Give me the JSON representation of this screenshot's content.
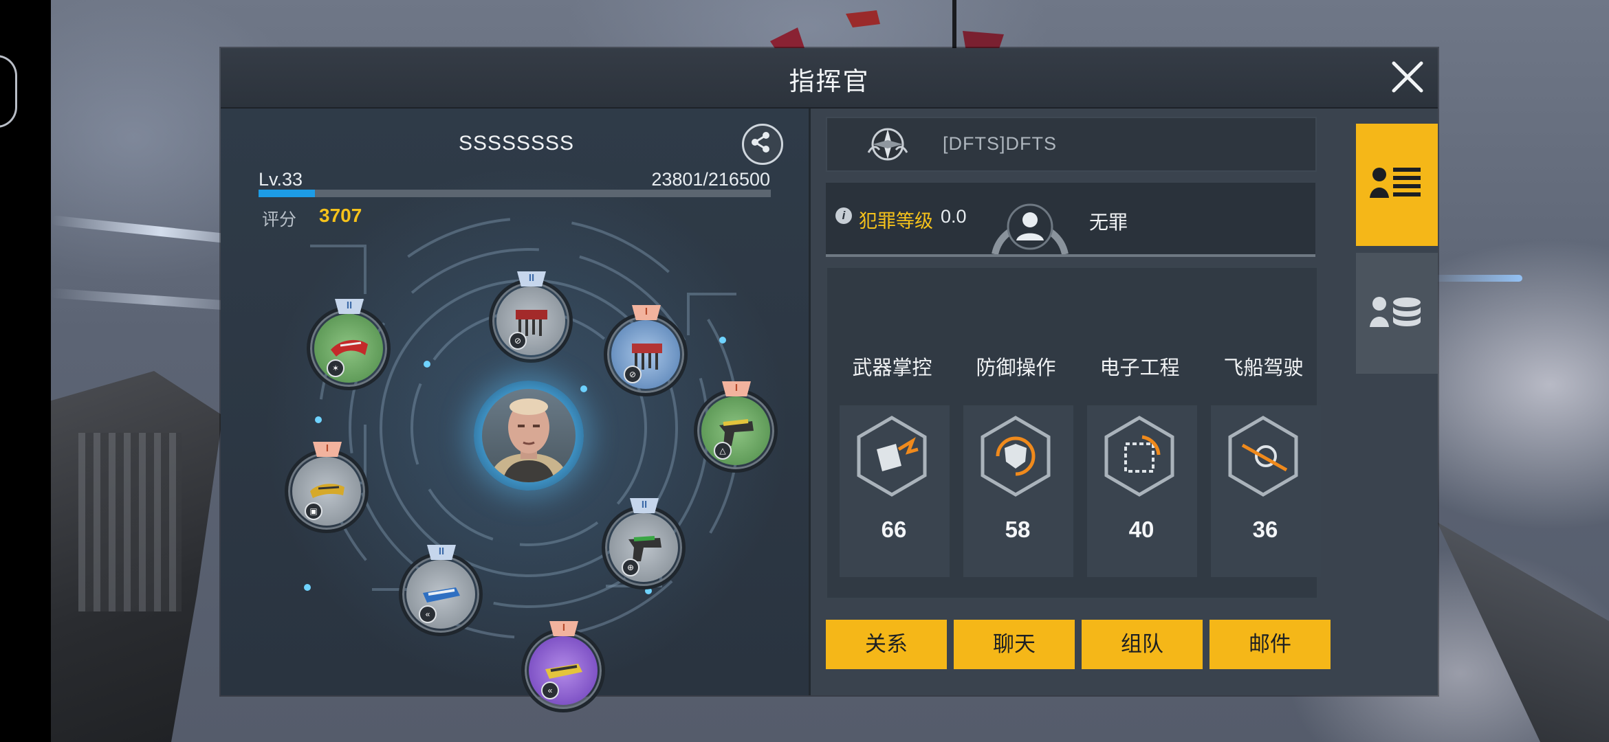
{
  "dialog": {
    "title": "指挥官",
    "close_icon": "close-icon"
  },
  "player": {
    "name": "SSSSSSSS",
    "level_text": "Lv.33",
    "exp_text": "23801/216500",
    "exp_fraction": 0.11,
    "score_label": "评分",
    "score_value": "3707"
  },
  "modules": [
    {
      "tier": "II",
      "color": "green"
    },
    {
      "tier": "II",
      "color": "gray"
    },
    {
      "tier": "I",
      "color": "blue"
    },
    {
      "tier": "I",
      "color": "green"
    },
    {
      "tier": "I",
      "color": "gray"
    },
    {
      "tier": "II",
      "color": "gray"
    },
    {
      "tier": "II",
      "color": "gray"
    },
    {
      "tier": "I",
      "color": "purple"
    }
  ],
  "guild": {
    "name": "[DFTS]DFTS"
  },
  "crime": {
    "label": "犯罪等级",
    "value": "0.0",
    "status": "无罪"
  },
  "skills": [
    {
      "label": "武器掌控",
      "value": "66",
      "icon": "weapon-skill-icon"
    },
    {
      "label": "防御操作",
      "value": "58",
      "icon": "defense-skill-icon"
    },
    {
      "label": "电子工程",
      "value": "40",
      "icon": "electronics-skill-icon"
    },
    {
      "label": "飞船驾驶",
      "value": "36",
      "icon": "piloting-skill-icon"
    }
  ],
  "actions": [
    "关系",
    "聊天",
    "组队",
    "邮件"
  ],
  "tabs": {
    "profile_icon": "profile-list-icon",
    "resources_icon": "profile-database-icon"
  },
  "colors": {
    "accent": "#f5b718",
    "score": "#f5c21b",
    "exp_bar": "#1d9ce6"
  }
}
